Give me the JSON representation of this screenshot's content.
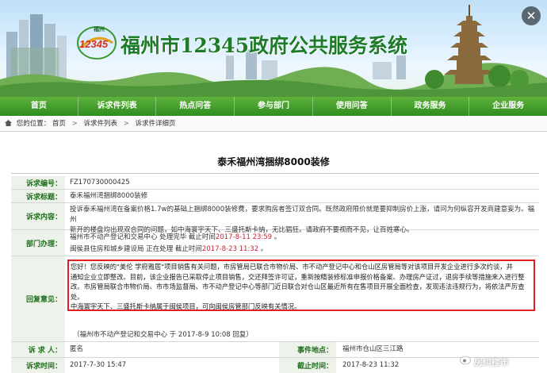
{
  "header": {
    "logo_text": "12345",
    "logo_city": "福州",
    "site_title": "福州市12345政府公共服务系统",
    "close_symbol": "✕"
  },
  "nav": [
    "首页",
    "诉求件列表",
    "热点问答",
    "参与部门",
    "使用问答",
    "政务服务",
    "企业服务"
  ],
  "breadcrumb": {
    "prefix": "您的位置：",
    "items": [
      "首页",
      "诉求件列表",
      "诉求件详细页"
    ]
  },
  "title": "泰禾福州湾捆绑8000装修",
  "fields": {
    "number": {
      "label": "诉求编号：",
      "value": "FZ170730000425"
    },
    "subject": {
      "label": "诉求标题：",
      "value": "泰禾福州湾捆绑8000装修"
    },
    "content": {
      "label": "诉求内容：",
      "lines": [
        "投诉泰禾福州湾在备案价格1.7w的基础上捆绑8000装修费，要求购房者签订双合同。既然政府限价就是要抑制房价上涨，请问为何纵容开发商建意妄为。福州",
        "新开的楼盘均出现双合同的问题，如中海寰宇天下、三盛托斯卡纳，无比猖狂。请政府不要视而不见，让百姓寒心。"
      ]
    },
    "dept": {
      "label": "部门办理：",
      "lines": [
        {
          "text": "福州市不动产登记和交易中心 处理完毕 截止时间",
          "time": "2017-8-11 23:59",
          "end": " 。"
        },
        {
          "text": "闽侯县住房和城乡建设局 正在处理 截止时间",
          "time": "2017-8-23 11:32",
          "end": " 。"
        }
      ]
    },
    "reply": {
      "label": "回复意见：",
      "lines": [
        "您好！您反映的\"美伦 学府雅居\"项目销售有关问题，市房管局已联合市物价局、市不动产登记中心和仓山区房管局等对该项目开发企业进行多次约谈，并",
        "通知企业立即整改。目前，该企业报告已采取停止项目销售，交还拜签许可证，重新按精装修标准申报价格备案、办理房产证过，退房手续等措施来入进行整",
        "改。市房管局联合市物价局、市市场监督局、市不动产登记中心等部门近日联合对仓山区最近所有在售项目开展全面检查，发现违法违规行为，将依法严厉查处。",
        "中海寰宇天下、三盛托斯卡纳属于闽侯项目，可向闽侯房管部门反映有关情况。"
      ]
    },
    "reply_source": "（福州市不动产登记和交易中心 于 2017-8-9 10:08 回复）",
    "requester": {
      "label": "诉 求 人：",
      "value": "匿名"
    },
    "location": {
      "label": "事件地点：",
      "value": "福州市仓山区三江路"
    },
    "req_time": {
      "label": "诉求时间：",
      "value": "2017-7-30 15:47"
    },
    "deadline": {
      "label": "截止时间：",
      "value": "2017-8-23 11:32"
    }
  },
  "watermark": "房纠楼市"
}
